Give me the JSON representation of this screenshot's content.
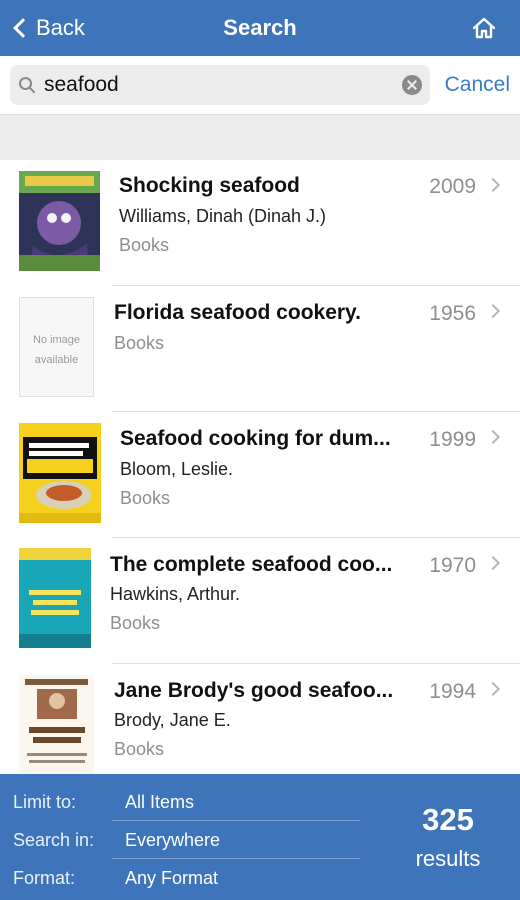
{
  "navbar": {
    "back_label": "Back",
    "title": "Search",
    "bg_color": "#3e74ba"
  },
  "search": {
    "value": "seafood",
    "cancel_label": "Cancel"
  },
  "results": [
    {
      "title": "Shocking seafood",
      "author": "Williams, Dinah (Dinah J.)",
      "type": "Books",
      "year": "2009",
      "cover": "cover-illustration"
    },
    {
      "title": "Florida seafood cookery.",
      "author": "",
      "type": "Books",
      "year": "1956",
      "cover": "no-image",
      "no_image_text": "No image available"
    },
    {
      "title": "Seafood cooking for dum...",
      "author": "Bloom, Leslie.",
      "type": "Books",
      "year": "1999",
      "cover": "dummies-cover"
    },
    {
      "title": "The complete seafood coo...",
      "author": "Hawkins, Arthur.",
      "type": "Books",
      "year": "1970",
      "cover": "teal-cover"
    },
    {
      "title": "Jane Brody's good seafoo...",
      "author": "Brody, Jane E.",
      "type": "Books",
      "year": "1994",
      "cover": "brody-cover"
    }
  ],
  "footer": {
    "filters": [
      {
        "label": "Limit to:",
        "value": "All Items"
      },
      {
        "label": "Search in:",
        "value": "Everywhere"
      },
      {
        "label": "Format:",
        "value": "Any Format"
      }
    ],
    "count": "325",
    "count_label": "results"
  }
}
